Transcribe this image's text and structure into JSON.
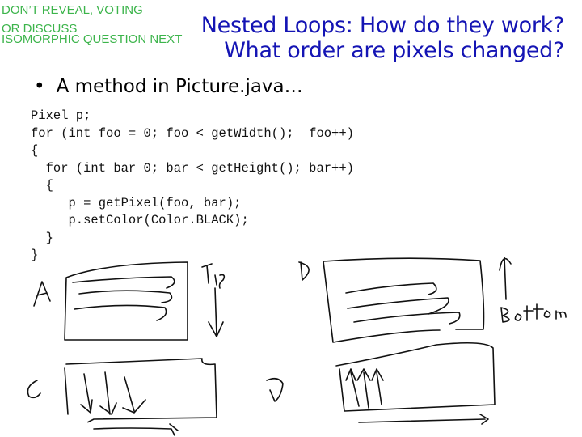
{
  "slide": {
    "instructor_note": [
      "DON’T REVEAL, VOTING",
      " OR DISCUSS",
      "ISOMORPHIC QUESTION NEXT"
    ],
    "title_line1": "Nested Loops: How do they work?",
    "title_line2": "What order are pixels changed?",
    "bullet": "A method in Picture.java…",
    "code_lines": [
      "Pixel p;",
      "for (int foo = 0; foo < getWidth();  foo++)",
      "{",
      "  for (int bar 0; bar < getHeight(); bar++)",
      "  {",
      "     p = getPixel(foo, bar);",
      "     p.setColor(Color.BLACK);",
      "  }",
      "}"
    ],
    "sketches": {
      "A": {
        "label": "A",
        "annotation": "Top",
        "direction": "rows left-to-right, moving down"
      },
      "B": {
        "label": "B",
        "annotation": "Bottom",
        "direction": "rows left-to-right, moving up"
      },
      "C": {
        "label": "C",
        "direction": "columns top-to-bottom, moving right"
      },
      "D": {
        "label": "D",
        "direction": "columns bottom-to-top, moving right"
      }
    },
    "colors": {
      "note": "#3cb44b",
      "title": "#1414b4",
      "text": "#000000"
    }
  }
}
